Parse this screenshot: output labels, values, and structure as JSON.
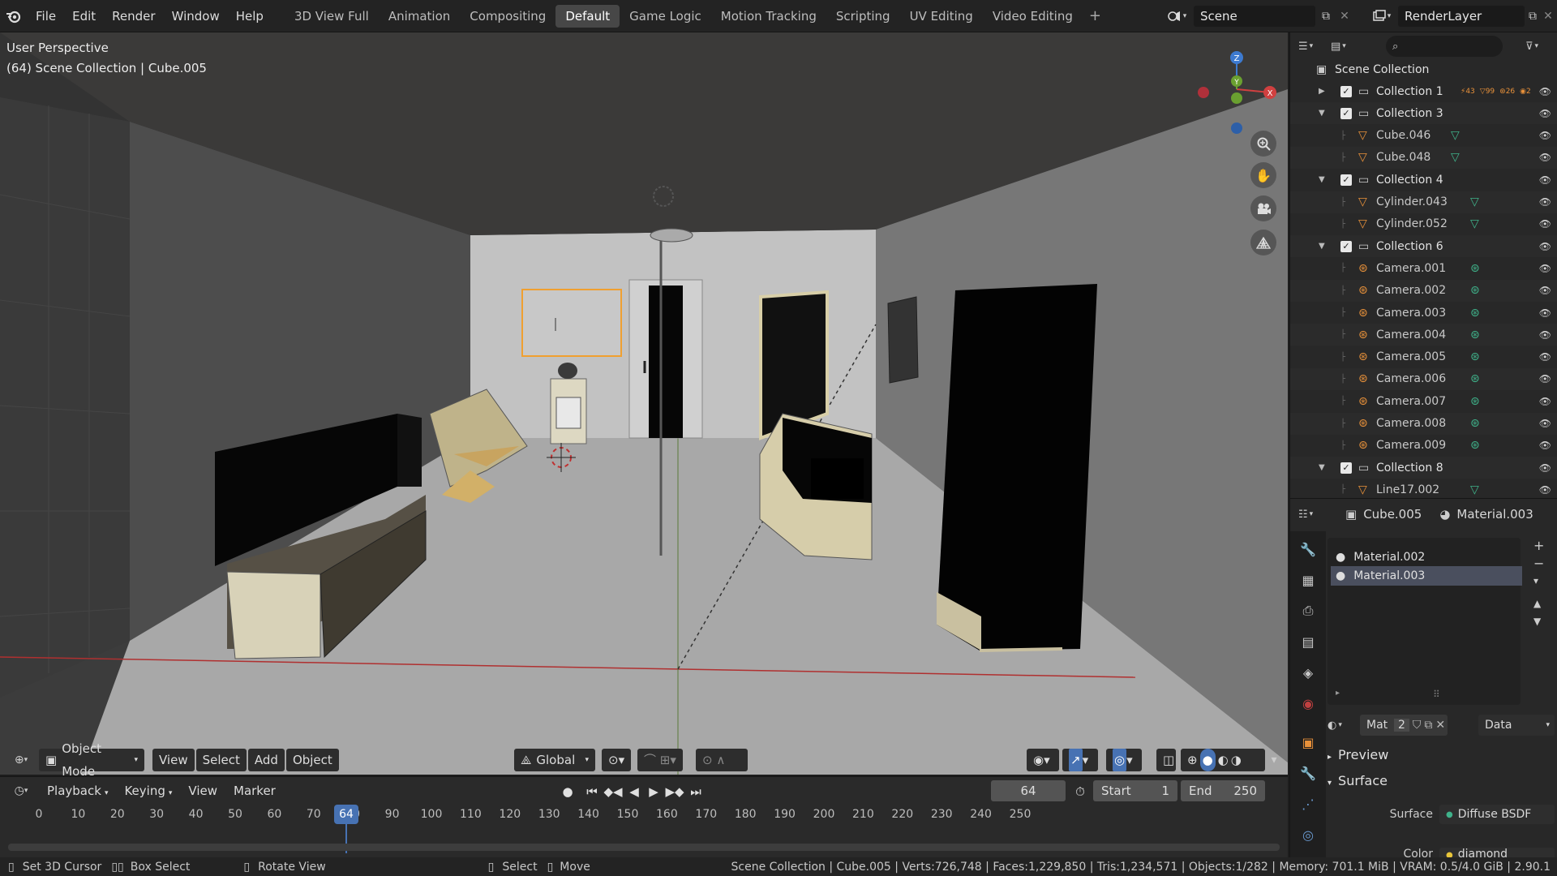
{
  "topbar": {
    "menus": [
      "File",
      "Edit",
      "Render",
      "Window",
      "Help"
    ],
    "workspaces": [
      "3D View Full",
      "Animation",
      "Compositing",
      "Default",
      "Game Logic",
      "Motion Tracking",
      "Scripting",
      "UV Editing",
      "Video Editing"
    ],
    "active_workspace": "Default",
    "scene": "Scene",
    "view_layer": "RenderLayer"
  },
  "viewport": {
    "perspective_label": "User Perspective",
    "collection_label": "(64) Scene Collection | Cube.005",
    "gizmo_axes": {
      "x": "X",
      "y": "Y",
      "z": "Z"
    },
    "header": {
      "mode": "Object Mode",
      "menus": [
        "View",
        "Select",
        "Add",
        "Object"
      ],
      "transform_orientation": "Global"
    }
  },
  "timeline": {
    "menus": [
      "Playback",
      "Keying",
      "View",
      "Marker"
    ],
    "current_frame": "64",
    "start_label": "Start",
    "start_value": "1",
    "end_label": "End",
    "end_value": "250",
    "ticks": [
      "0",
      "10",
      "20",
      "30",
      "40",
      "50",
      "60",
      "70",
      "80",
      "90",
      "100",
      "110",
      "120",
      "130",
      "140",
      "150",
      "160",
      "170",
      "180",
      "190",
      "200",
      "210",
      "220",
      "230",
      "240",
      "250"
    ]
  },
  "outliner": {
    "search_placeholder": "",
    "root": "Scene Collection",
    "collection1_stats": [
      "43",
      "99",
      "26",
      "2"
    ],
    "rows": [
      {
        "label": "Collection 1",
        "kind": "collection",
        "depth": 0,
        "expanded": false
      },
      {
        "label": "Collection 3",
        "kind": "collection",
        "depth": 0,
        "expanded": true
      },
      {
        "label": "Cube.046",
        "kind": "mesh",
        "depth": 1
      },
      {
        "label": "Cube.048",
        "kind": "mesh",
        "depth": 1
      },
      {
        "label": "Collection 4",
        "kind": "collection",
        "depth": 0,
        "expanded": true
      },
      {
        "label": "Cylinder.043",
        "kind": "mesh",
        "depth": 1
      },
      {
        "label": "Cylinder.052",
        "kind": "mesh",
        "depth": 1
      },
      {
        "label": "Collection 6",
        "kind": "collection",
        "depth": 0,
        "expanded": true
      },
      {
        "label": "Camera.001",
        "kind": "camera",
        "depth": 1
      },
      {
        "label": "Camera.002",
        "kind": "camera",
        "depth": 1
      },
      {
        "label": "Camera.003",
        "kind": "camera",
        "depth": 1
      },
      {
        "label": "Camera.004",
        "kind": "camera",
        "depth": 1
      },
      {
        "label": "Camera.005",
        "kind": "camera",
        "depth": 1
      },
      {
        "label": "Camera.006",
        "kind": "camera",
        "depth": 1
      },
      {
        "label": "Camera.007",
        "kind": "camera",
        "depth": 1
      },
      {
        "label": "Camera.008",
        "kind": "camera",
        "depth": 1
      },
      {
        "label": "Camera.009",
        "kind": "camera",
        "depth": 1
      },
      {
        "label": "Collection 8",
        "kind": "collection",
        "depth": 0,
        "expanded": true
      },
      {
        "label": "Line17.002",
        "kind": "mesh",
        "depth": 1
      }
    ]
  },
  "properties": {
    "object": "Cube.005",
    "material": "Material.003",
    "slots": [
      "Material.002",
      "Material.003"
    ],
    "active_slot": 1,
    "mat_label": "Mat",
    "users": "2",
    "link": "Data",
    "preview_label": "Preview",
    "surface_section": "Surface",
    "surface_label": "Surface",
    "surface_value": "Diffuse BSDF",
    "color_label": "Color",
    "color_value": "diamond plate.png"
  },
  "statusbar": {
    "left1": "Set 3D Cursor",
    "left2": "Box Select",
    "left3": "Rotate View",
    "mid1": "Select",
    "mid2": "Move",
    "stats": "Scene Collection | Cube.005 | Verts:726,748 | Faces:1,229,850 | Tris:1,234,571 | Objects:1/282 | Memory: 701.1 MiB | VRAM: 0.5/4.0 GiB | 2.90.1"
  },
  "colors": {
    "accent": "#4772b3",
    "selection": "#f0a030",
    "mesh_icon": "#e8913a",
    "data_icon": "#3fb28a"
  }
}
